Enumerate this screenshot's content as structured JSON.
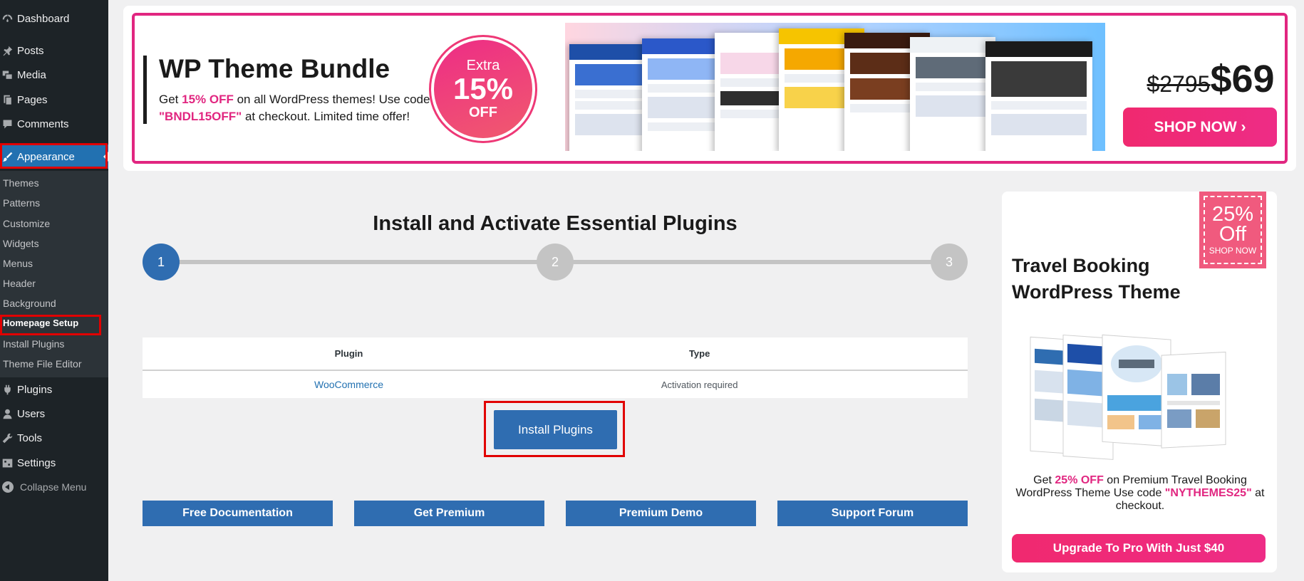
{
  "sidebar": {
    "menu": [
      {
        "label": "Dashboard",
        "icon": "dashboard-icon"
      },
      {
        "label": "Posts",
        "icon": "pin-icon"
      },
      {
        "label": "Media",
        "icon": "media-icon"
      },
      {
        "label": "Pages",
        "icon": "pages-icon"
      },
      {
        "label": "Comments",
        "icon": "comment-icon"
      },
      {
        "label": "Appearance",
        "icon": "brush-icon"
      }
    ],
    "submenu": [
      "Themes",
      "Patterns",
      "Customize",
      "Widgets",
      "Menus",
      "Header",
      "Background",
      "Homepage Setup",
      "Install Plugins",
      "Theme File Editor"
    ],
    "menu_bottom": [
      {
        "label": "Plugins",
        "icon": "plugin-icon"
      },
      {
        "label": "Users",
        "icon": "user-icon"
      },
      {
        "label": "Tools",
        "icon": "wrench-icon"
      },
      {
        "label": "Settings",
        "icon": "settings-icon"
      }
    ],
    "collapse_label": "Collapse Menu"
  },
  "banner": {
    "title": "WP Theme Bundle",
    "desc_1": "Get ",
    "desc_highlight_1": "15% OFF",
    "desc_2": " on all WordPress themes! Use code ",
    "desc_highlight_2": "\"BNDL15OFF\"",
    "desc_3": " at checkout. Limited time offer!",
    "badge_extra": "Extra",
    "badge_pct": "15%",
    "badge_off": "OFF",
    "old_price": "$2795",
    "new_price": "$69",
    "shop_button": "SHOP NOW ›"
  },
  "main": {
    "title": "Install and Activate Essential Plugins",
    "steps": [
      "1",
      "2",
      "3"
    ],
    "table_headers": {
      "plugin": "Plugin",
      "type": "Type"
    },
    "plugins": [
      {
        "name": "WooCommerce",
        "type": "Activation required"
      }
    ],
    "install_button": "Install Plugins",
    "links": [
      "Free Documentation",
      "Get Premium",
      "Premium Demo",
      "Support Forum"
    ]
  },
  "promo": {
    "tag_pct": "25%",
    "tag_off": "Off",
    "tag_shop": "SHOP NOW",
    "title": "Travel Booking WordPress Theme",
    "text_1": "Get ",
    "text_highlight_1": "25% OFF",
    "text_2": " on Premium Travel Booking WordPress Theme Use code ",
    "text_highlight_2": "\"NYTHEMES25\"",
    "text_3": " at checkout.",
    "upgrade_button": "Upgrade To Pro With Just $40"
  },
  "colors": {
    "sidebar_bg": "#1d2327",
    "accent_blue": "#2f6db1",
    "wp_blue": "#2271b1",
    "promo_pink": "#e12680",
    "highlight_red": "#e10000"
  }
}
